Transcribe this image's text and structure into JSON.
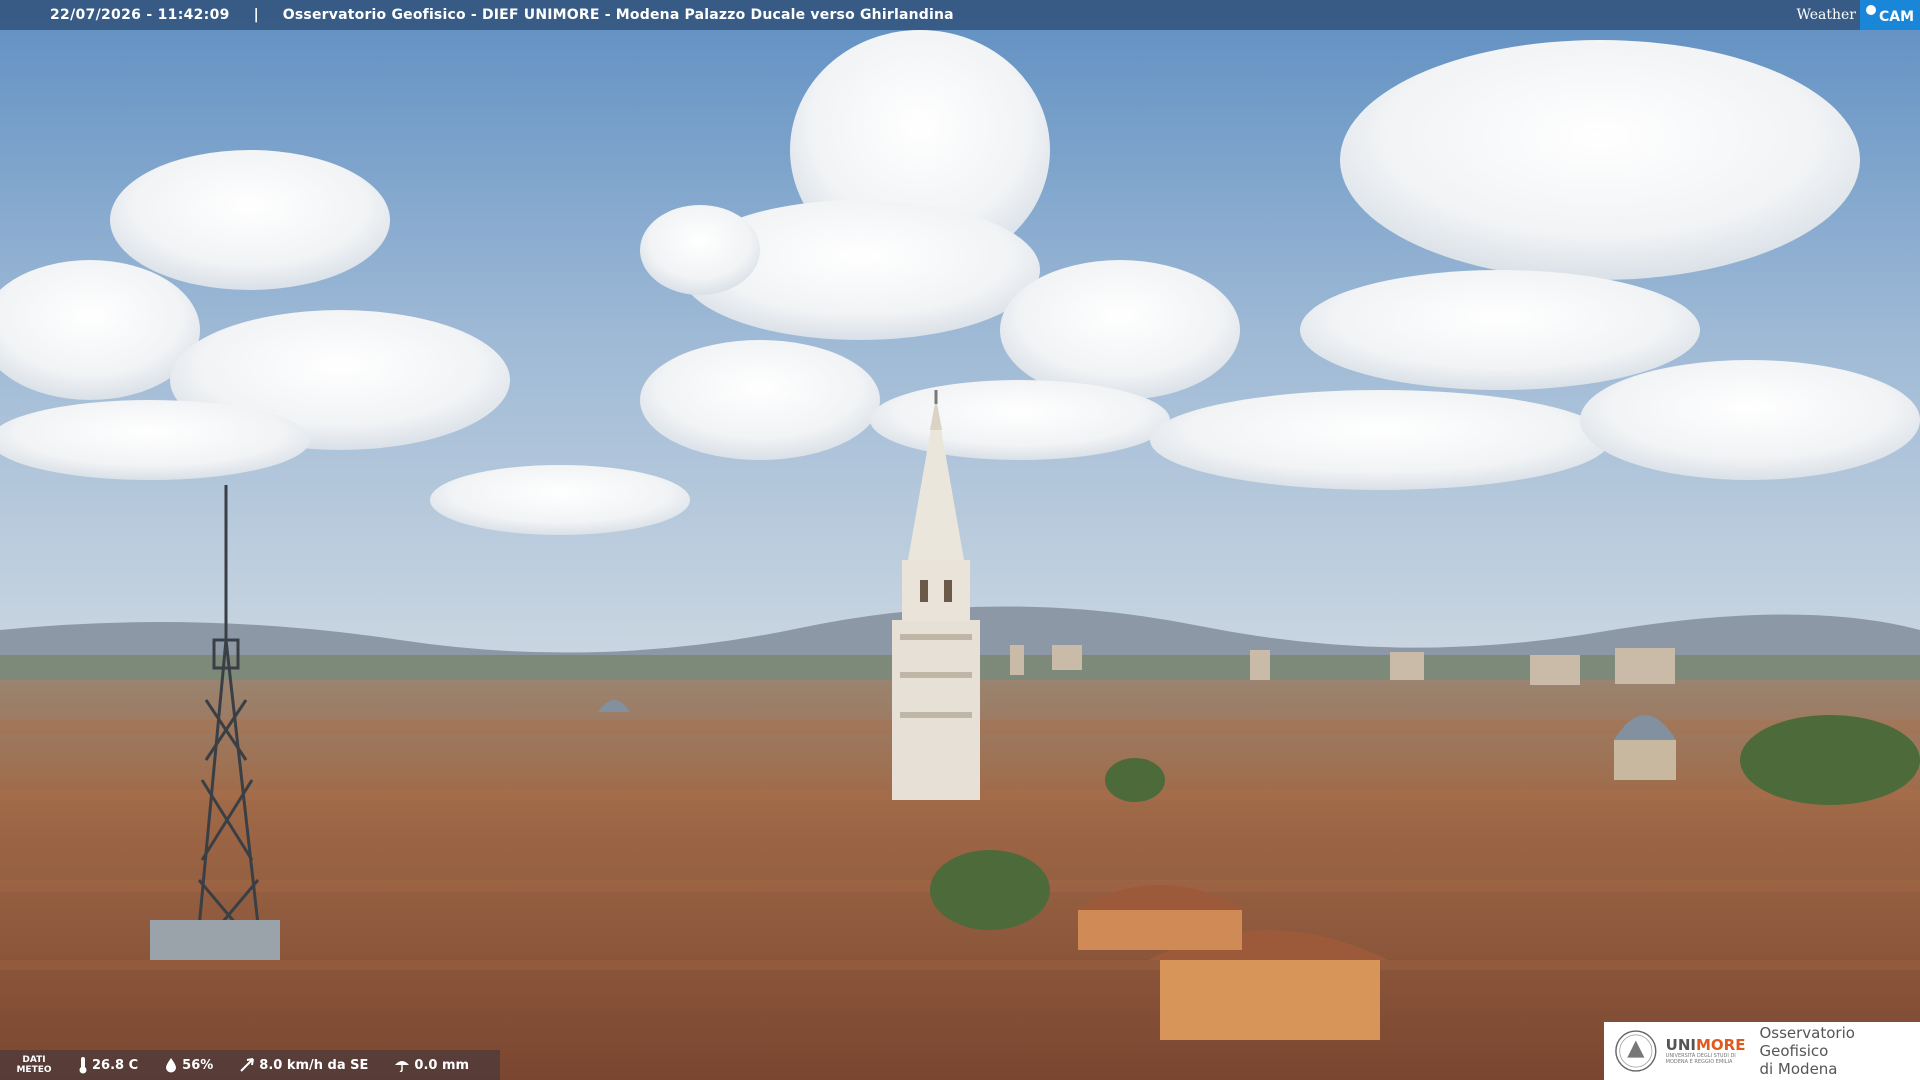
{
  "header": {
    "timestamp": "22/07/2026 - 11:42:09",
    "separator": "|",
    "location": "Osservatorio Geofisico - DIEF UNIMORE - Modena Palazzo Ducale verso Ghirlandina"
  },
  "brand": {
    "weather": "Weather",
    "cam": "CAM"
  },
  "meteo": {
    "label_line1": "DATI",
    "label_line2": "METEO",
    "temperature": "26.8 C",
    "humidity": "56%",
    "wind": "8.0 km/h da SE",
    "rain": "0.0 mm"
  },
  "logo": {
    "uni_part1": "UNI",
    "uni_part2": "MORE",
    "uni_sub1": "UNIVERSITÀ DEGLI STUDI DI",
    "uni_sub2": "MODENA E REGGIO EMILIA",
    "obs_line1": "Osservatorio Geofisico",
    "obs_line2": "di Modena"
  },
  "colors": {
    "sky_top": "#6f9bc9",
    "sky_bottom": "#c7d5e2",
    "roof": "#a0623e",
    "accent": "#e05a1e",
    "wcam_blue": "#1a86d8"
  }
}
